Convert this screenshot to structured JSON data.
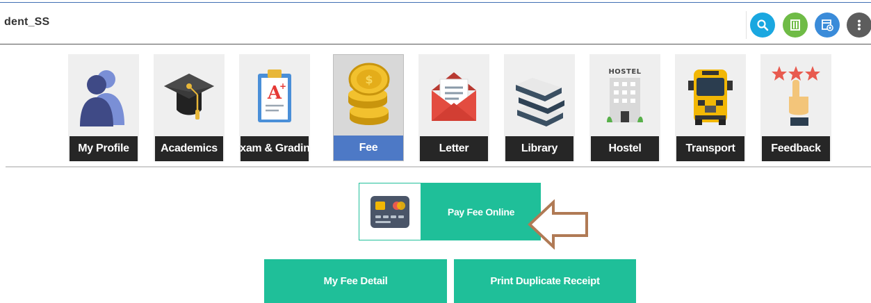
{
  "header": {
    "user_name": "dent_SS",
    "buttons": [
      {
        "icon": "search-icon",
        "color": "#1aa7e0"
      },
      {
        "icon": "barcode-icon",
        "color": "#6fbb46"
      },
      {
        "icon": "add-window-icon",
        "color": "#3a8bd9"
      },
      {
        "icon": "more-vertical-icon",
        "color": "#5d5d5d"
      }
    ]
  },
  "modules": [
    {
      "label": "My Profile",
      "icon": "profile-icon"
    },
    {
      "label": "Academics",
      "icon": "graduation-cap-icon"
    },
    {
      "label": "Exam & Grading",
      "icon": "exam-clipboard-icon"
    },
    {
      "label": "Fee",
      "icon": "coins-icon",
      "active": true
    },
    {
      "label": "Letter",
      "icon": "envelope-icon"
    },
    {
      "label": "Library",
      "icon": "books-icon"
    },
    {
      "label": "Hostel",
      "icon": "hostel-building-icon",
      "icon_text": "HOSTEL"
    },
    {
      "label": "Transport",
      "icon": "school-bus-icon"
    },
    {
      "label": "Feedback",
      "icon": "stars-feedback-icon"
    }
  ],
  "fee": {
    "pay_online_label": "Pay Fee Online",
    "my_fee_detail_label": "My Fee Detail",
    "print_receipt_label": "Print Duplicate Receipt"
  },
  "colors": {
    "accent": "#1fbf99",
    "active_tab": "#4d79c6",
    "tab_label_bg": "#262626",
    "arrow": "#b07a55"
  }
}
